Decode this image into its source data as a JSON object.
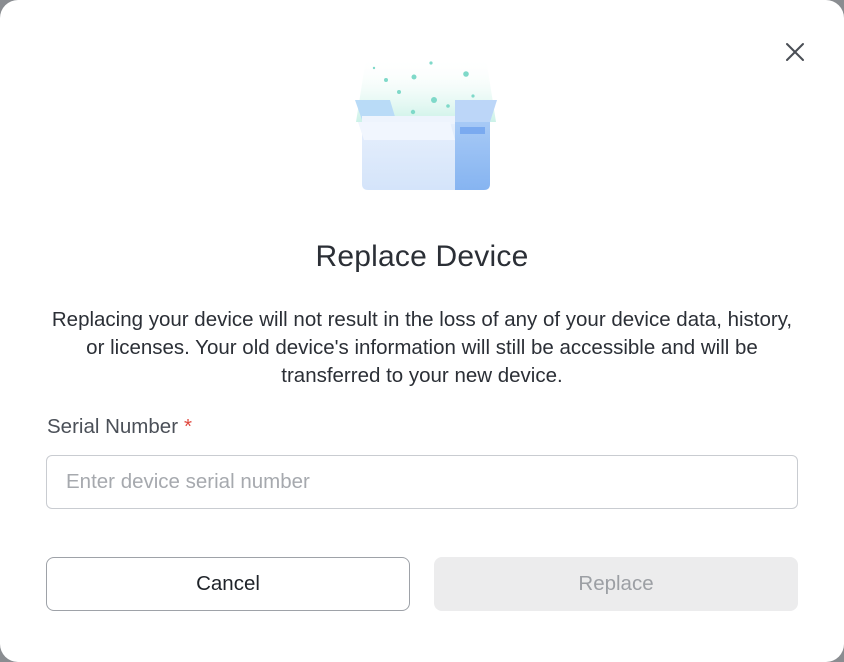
{
  "dialog": {
    "title": "Replace Device",
    "description": "Replacing your device will not result in the loss of any of your device data, history, or licenses. Your old device's information will still be accessible and will be transferred to your new device.",
    "close_icon": "close-icon",
    "illustration_icon": "open-box-icon"
  },
  "form": {
    "serial_label": "Serial Number",
    "required_marker": "*",
    "serial_placeholder": "Enter device serial number",
    "serial_value": ""
  },
  "actions": {
    "cancel_label": "Cancel",
    "replace_label": "Replace",
    "replace_disabled": true
  },
  "colors": {
    "required": "#e0483e",
    "box_light": "#dbe8fb",
    "box_dark": "#8fbaf3",
    "sparkle": "#7fd9c9"
  }
}
